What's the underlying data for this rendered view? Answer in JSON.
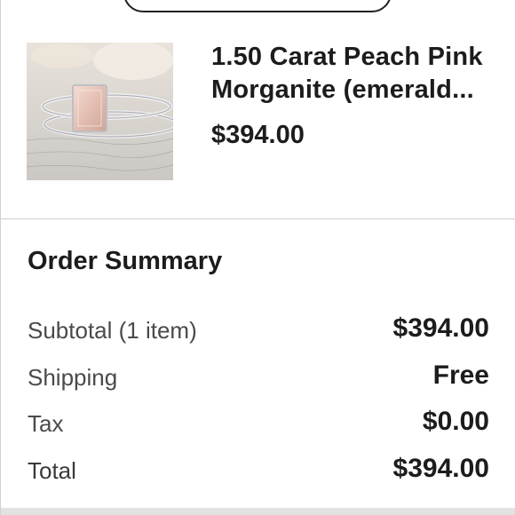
{
  "product": {
    "title_line1": "1.50 Carat Peach Pink",
    "title_line2": "Morganite (emerald...",
    "price": "$394.00",
    "image_alt": "morganite-ring-photo"
  },
  "summary": {
    "title": "Order Summary",
    "rows": [
      {
        "label": "Subtotal (1 item)",
        "value": "$394.00"
      },
      {
        "label": "Shipping",
        "value": "Free"
      },
      {
        "label": "Tax",
        "value": "$0.00"
      },
      {
        "label": "Total",
        "value": "$394.00"
      }
    ]
  },
  "colors": {
    "text_primary": "#1c1c1c",
    "text_secondary": "#4a4a4a",
    "divider": "#cfcfcf"
  }
}
